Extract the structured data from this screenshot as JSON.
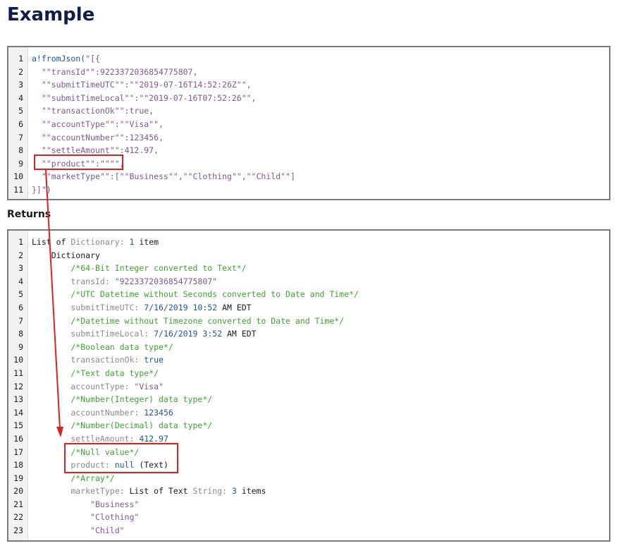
{
  "page": {
    "title": "Example",
    "returns_label": "Returns"
  },
  "input_code": [
    {
      "n": "1",
      "tokens": [
        {
          "t": "a!fromJson(",
          "c": "fn"
        },
        {
          "t": "\"[{",
          "c": "str"
        }
      ]
    },
    {
      "n": "2",
      "tokens": [
        {
          "t": "  \"\"transId\"\":9223372036854775807,",
          "c": "str"
        }
      ]
    },
    {
      "n": "3",
      "tokens": [
        {
          "t": "  \"\"submitTimeUTC\"\":\"\"2019-07-16T14:52:26Z\"\",",
          "c": "str"
        }
      ]
    },
    {
      "n": "4",
      "tokens": [
        {
          "t": "  \"\"submitTimeLocal\"\":\"\"2019-07-16T07:52:26\"\",",
          "c": "str"
        }
      ]
    },
    {
      "n": "5",
      "tokens": [
        {
          "t": "  \"\"transactionOk\"\":true,",
          "c": "str"
        }
      ]
    },
    {
      "n": "6",
      "tokens": [
        {
          "t": "  \"\"accountType\"\":\"\"Visa\"\",",
          "c": "str"
        }
      ]
    },
    {
      "n": "7",
      "tokens": [
        {
          "t": "  \"\"accountNumber\"\":123456,",
          "c": "str"
        }
      ]
    },
    {
      "n": "8",
      "tokens": [
        {
          "t": "  \"\"settleAmount\"\":412.97,",
          "c": "str"
        }
      ]
    },
    {
      "n": "9",
      "tokens": [
        {
          "t": "  \"\"product\"\":\"\"\"\",",
          "c": "str"
        }
      ]
    },
    {
      "n": "10",
      "tokens": [
        {
          "t": "  \"\"marketType\"\":[\"\"Business\"\",\"\"Clothing\"\",\"\"Child\"\"]",
          "c": "str"
        }
      ]
    },
    {
      "n": "11",
      "tokens": [
        {
          "t": "}]\"",
          "c": "str"
        },
        {
          "t": ")",
          "c": "fn"
        }
      ]
    }
  ],
  "output_code": [
    {
      "n": "1",
      "tokens": [
        {
          "t": "List of ",
          "c": "plain"
        },
        {
          "t": "Dictionary",
          "c": "type"
        },
        {
          "t": ": ",
          "c": "type"
        },
        {
          "t": "1",
          "c": "num"
        },
        {
          "t": " item",
          "c": "plain"
        }
      ]
    },
    {
      "n": "2",
      "tokens": [
        {
          "t": "    Dictionary",
          "c": "plain"
        }
      ]
    },
    {
      "n": "3",
      "tokens": [
        {
          "t": "        /*64-Bit Integer converted to Text*/",
          "c": "comment"
        }
      ]
    },
    {
      "n": "4",
      "tokens": [
        {
          "t": "        transId: ",
          "c": "key"
        },
        {
          "t": "\"9223372036854775807\"",
          "c": "str"
        }
      ]
    },
    {
      "n": "5",
      "tokens": [
        {
          "t": "        /*UTC Datetime without Seconds converted to Date and Time*/",
          "c": "comment"
        }
      ]
    },
    {
      "n": "6",
      "tokens": [
        {
          "t": "        submitTimeUTC: ",
          "c": "key"
        },
        {
          "t": "7/16/2019 10:52",
          "c": "num"
        },
        {
          "t": " AM EDT",
          "c": "plain"
        }
      ]
    },
    {
      "n": "7",
      "tokens": [
        {
          "t": "        /*Datetime without Timezone converted to Date and Time*/",
          "c": "comment"
        }
      ]
    },
    {
      "n": "8",
      "tokens": [
        {
          "t": "        submitTimeLocal: ",
          "c": "key"
        },
        {
          "t": "7/16/2019 3:52",
          "c": "num"
        },
        {
          "t": " AM EDT",
          "c": "plain"
        }
      ]
    },
    {
      "n": "9",
      "tokens": [
        {
          "t": "        /*Boolean data type*/",
          "c": "comment"
        }
      ]
    },
    {
      "n": "10",
      "tokens": [
        {
          "t": "        transactionOk: ",
          "c": "key"
        },
        {
          "t": "true",
          "c": "kw"
        }
      ]
    },
    {
      "n": "11",
      "tokens": [
        {
          "t": "        /*Text data type*/",
          "c": "comment"
        }
      ]
    },
    {
      "n": "12",
      "tokens": [
        {
          "t": "        accountType: ",
          "c": "key"
        },
        {
          "t": "\"Visa\"",
          "c": "str"
        }
      ]
    },
    {
      "n": "13",
      "tokens": [
        {
          "t": "        /*Number(Integer) data type*/",
          "c": "comment"
        }
      ]
    },
    {
      "n": "14",
      "tokens": [
        {
          "t": "        accountNumber: ",
          "c": "key"
        },
        {
          "t": "123456",
          "c": "num"
        }
      ]
    },
    {
      "n": "15",
      "tokens": [
        {
          "t": "        /*Number(Decimal) data type*/",
          "c": "comment"
        }
      ]
    },
    {
      "n": "16",
      "tokens": [
        {
          "t": "        settleAmount: ",
          "c": "key"
        },
        {
          "t": "412.97",
          "c": "num"
        }
      ]
    },
    {
      "n": "17",
      "tokens": [
        {
          "t": "        /*Null value*/",
          "c": "comment"
        }
      ]
    },
    {
      "n": "18",
      "tokens": [
        {
          "t": "        product: ",
          "c": "key"
        },
        {
          "t": "null",
          "c": "kw"
        },
        {
          "t": " (Text)",
          "c": "plain"
        }
      ]
    },
    {
      "n": "19",
      "tokens": [
        {
          "t": "        /*Array*/",
          "c": "comment"
        }
      ]
    },
    {
      "n": "20",
      "tokens": [
        {
          "t": "        marketType: ",
          "c": "key"
        },
        {
          "t": "List of Text ",
          "c": "plain"
        },
        {
          "t": "String",
          "c": "type"
        },
        {
          "t": ": ",
          "c": "type"
        },
        {
          "t": "3",
          "c": "num"
        },
        {
          "t": " items",
          "c": "plain"
        }
      ]
    },
    {
      "n": "21",
      "tokens": [
        {
          "t": "            \"Business\"",
          "c": "str"
        }
      ]
    },
    {
      "n": "22",
      "tokens": [
        {
          "t": "            \"Clothing\"",
          "c": "str"
        }
      ]
    },
    {
      "n": "23",
      "tokens": [
        {
          "t": "            \"Child\"",
          "c": "str"
        }
      ]
    }
  ],
  "annotations": {
    "color": "#e02020"
  }
}
